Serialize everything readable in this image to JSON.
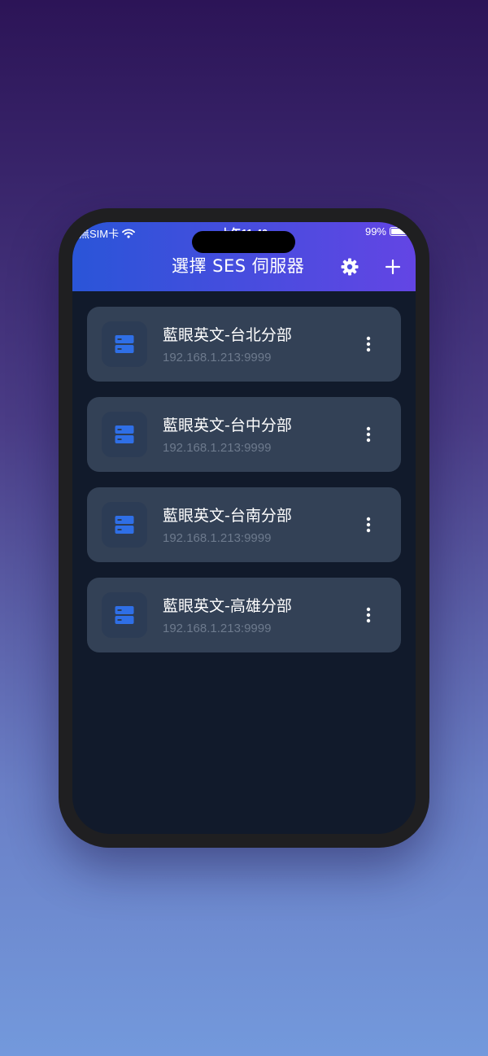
{
  "status_bar": {
    "carrier": "無SIM卡",
    "time": "上午11:40",
    "battery_percent": "99%",
    "battery_level": 0.99
  },
  "header": {
    "title": "選擇 SES 伺服器",
    "settings_icon": "gear-icon",
    "add_icon": "plus-icon",
    "gradient_start": "#2a55d8",
    "gradient_end": "#6345e4"
  },
  "servers": [
    {
      "name": "藍眼英文-台北分部",
      "address": "192.168.1.213:9999"
    },
    {
      "name": "藍眼英文-台中分部",
      "address": "192.168.1.213:9999"
    },
    {
      "name": "藍眼英文-台南分部",
      "address": "192.168.1.213:9999"
    },
    {
      "name": "藍眼英文-高雄分部",
      "address": "192.168.1.213:9999"
    }
  ],
  "colors": {
    "screen_background": "#111a2b",
    "card_background": "#334156",
    "server_icon": "#2f6fe6"
  }
}
